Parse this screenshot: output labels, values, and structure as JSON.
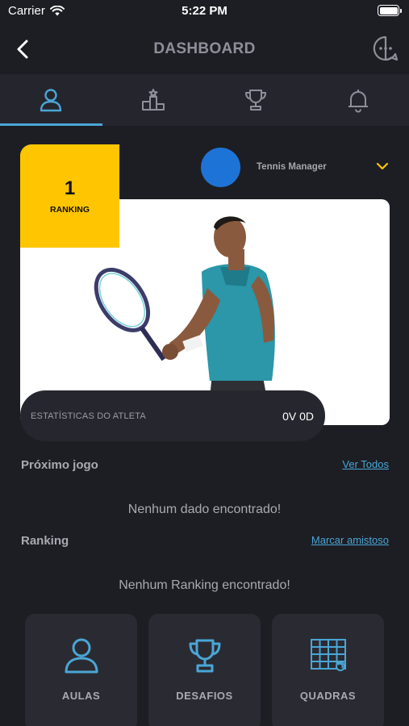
{
  "status_bar": {
    "carrier": "Carrier",
    "time": "5:22 PM"
  },
  "header": {
    "title": "DASHBOARD",
    "back_icon": "chevron-left-icon",
    "chat_icon": "chat-bubble-icon"
  },
  "tabs": [
    {
      "icon": "user-icon",
      "active": true
    },
    {
      "icon": "podium-icon",
      "active": false
    },
    {
      "icon": "trophy-icon",
      "active": false
    },
    {
      "icon": "bell-icon",
      "active": false
    }
  ],
  "athlete": {
    "ranking_position": "1",
    "ranking_label": "RANKING",
    "club_name": "Tennis Manager",
    "stats_label": "ESTATÍSTICAS DO ATLETA",
    "stats_value": "0V 0D"
  },
  "next_game": {
    "title": "Próximo jogo",
    "link": "Ver Todos",
    "empty": "Nenhum dado encontrado!"
  },
  "ranking": {
    "title": "Ranking",
    "link": "Marcar amistoso",
    "empty": "Nenhum Ranking encontrado!"
  },
  "tiles": [
    {
      "label": "AULAS",
      "icon": "user-icon"
    },
    {
      "label": "DESAFIOS",
      "icon": "trophy-icon"
    },
    {
      "label": "QUADRAS",
      "icon": "court-grid-icon"
    }
  ],
  "colors": {
    "background": "#1d1e24",
    "accent": "#4aa6d6",
    "badge": "#ffc600",
    "avatar": "#1e73d6"
  }
}
